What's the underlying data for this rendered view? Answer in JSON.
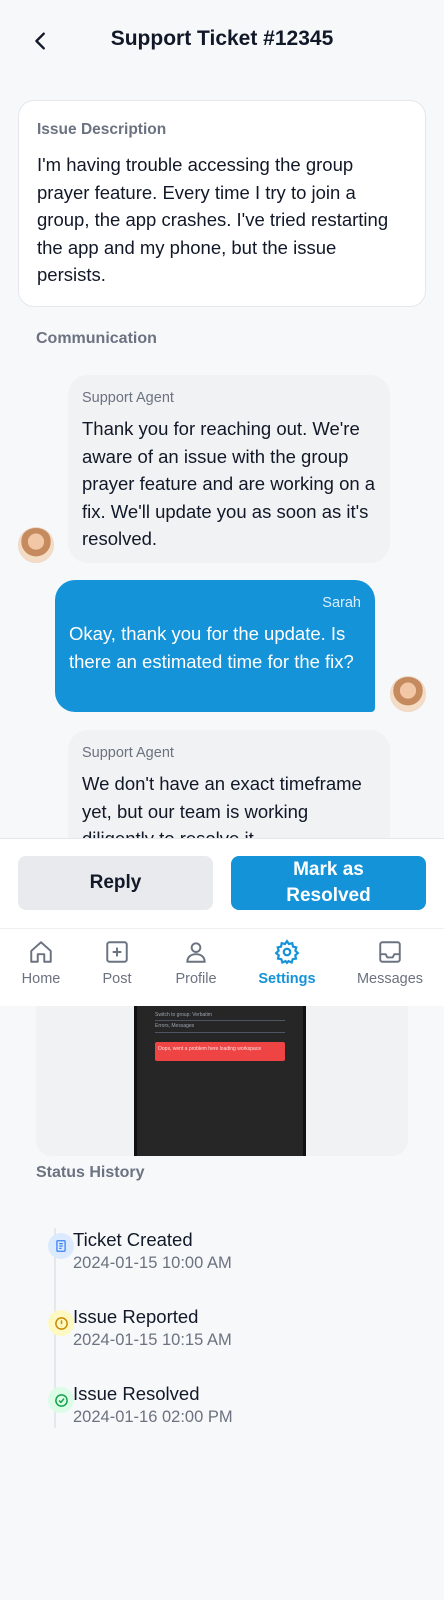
{
  "header": {
    "title": "Support Ticket #12345",
    "back_icon": "chevron-left-icon"
  },
  "issue": {
    "label": "Issue Description",
    "text": "I'm having trouble accessing the group prayer feature. Every time I try to join a group, the app crashes. I've tried restarting the app and my phone, but the issue persists."
  },
  "communication": {
    "label": "Communication",
    "messages": [
      {
        "sender": "Support Agent",
        "text": "Thank you for reaching out. We're aware of an issue with the group prayer feature and are working on a fix. We'll update you as soon as it's resolved."
      },
      {
        "sender": "Sarah",
        "text": "Okay, thank you for the update. Is there an estimated time for the fix?"
      },
      {
        "sender": "Support Agent",
        "text": "We don't have an exact timeframe yet, but our team is working diligently to resolve it"
      }
    ]
  },
  "actions": {
    "reply": "Reply",
    "resolve": "Mark as Resolved"
  },
  "nav": {
    "items": [
      {
        "label": "Home",
        "icon": "home-icon"
      },
      {
        "label": "Post",
        "icon": "plus-square-icon"
      },
      {
        "label": "Profile",
        "icon": "user-icon"
      },
      {
        "label": "Settings",
        "icon": "gear-icon",
        "active": true
      },
      {
        "label": "Messages",
        "icon": "inbox-icon"
      }
    ],
    "active_color": "#1593d8"
  },
  "attachment": {
    "line1": "Switch to group: Verbatim",
    "line2": "Errors, Messages",
    "alert": "Oops, went a problem here loading workspace"
  },
  "status_history": {
    "label": "Status History",
    "events": [
      {
        "title": "Ticket Created",
        "time": "2024-01-15 10:00 AM",
        "icon": "document-icon",
        "color": "#3b82f6"
      },
      {
        "title": "Issue Reported",
        "time": "2024-01-15 10:15 AM",
        "icon": "alert-circle-icon",
        "color": "#eab308"
      },
      {
        "title": "Issue Resolved",
        "time": "2024-01-16 02:00 PM",
        "icon": "check-circle-icon",
        "color": "#22c55e"
      }
    ]
  },
  "colors": {
    "primary": "#1593d8",
    "text": "#111827",
    "muted": "#6b7280"
  }
}
